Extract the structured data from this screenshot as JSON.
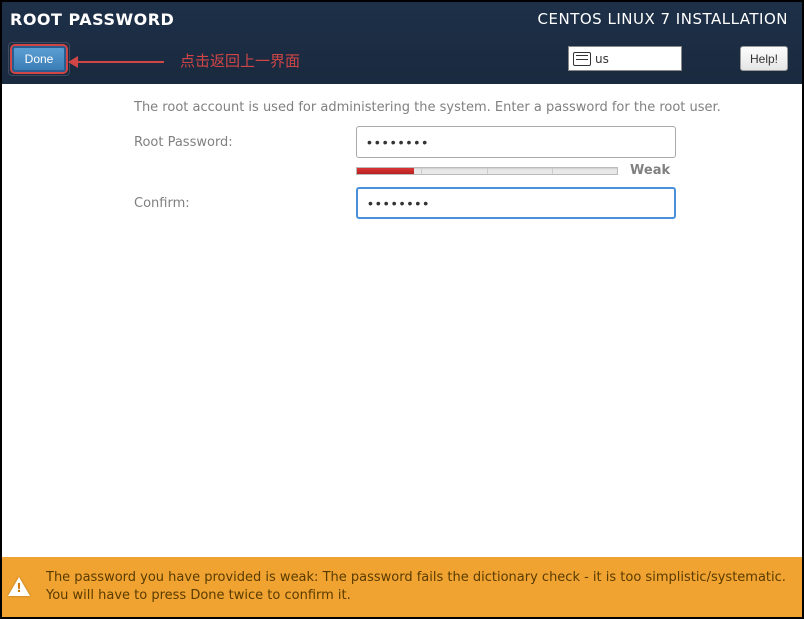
{
  "header": {
    "page_title": "ROOT PASSWORD",
    "done_label": "Done",
    "product_title": "CENTOS LINUX 7 INSTALLATION",
    "keyboard_layout": "us",
    "help_label": "Help!"
  },
  "annotation": {
    "text": "点击返回上一界面"
  },
  "form": {
    "intro": "The root account is used for administering the system.  Enter a password for the root user.",
    "root_label": "Root Password:",
    "root_value": "••••••••",
    "confirm_label": "Confirm:",
    "confirm_value": "••••••••",
    "strength_label": "Weak"
  },
  "warning": {
    "text": "The password you have provided is weak: The password fails the dictionary check - it is too simplistic/systematic. You will have to press Done twice to confirm it."
  }
}
